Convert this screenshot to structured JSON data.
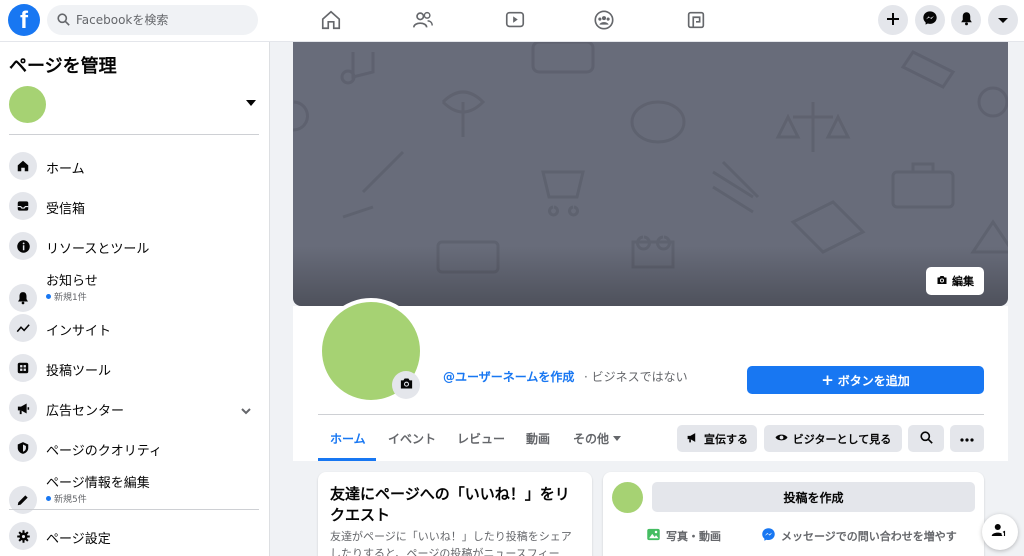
{
  "topbar": {
    "logo": "f",
    "search_placeholder": "Facebookを検索",
    "nav_icons": [
      "home-icon",
      "friends-icon",
      "watch-icon",
      "groups-icon",
      "gaming-icon"
    ],
    "action_icons": [
      "plus-icon",
      "messenger-icon",
      "notifications-icon",
      "account-menu-icon"
    ]
  },
  "sidebar": {
    "title": "ページを管理",
    "items": [
      {
        "label": "ホーム",
        "icon": "home-icon"
      },
      {
        "label": "受信箱",
        "icon": "inbox-icon"
      },
      {
        "label": "リソースとツール",
        "icon": "info-icon"
      },
      {
        "label": "お知らせ",
        "sub": "新規1件",
        "icon": "bell-icon"
      },
      {
        "label": "インサイト",
        "icon": "insights-icon"
      },
      {
        "label": "投稿ツール",
        "icon": "publishing-tools-icon"
      },
      {
        "label": "広告センター",
        "icon": "megaphone-icon"
      },
      {
        "label": "ページのクオリティ",
        "icon": "shield-icon"
      },
      {
        "label": "ページ情報を編集",
        "sub": "新規5件",
        "icon": "pencil-icon"
      },
      {
        "label": "ページ設定",
        "icon": "gear-icon"
      }
    ]
  },
  "cover": {
    "edit_label": "編集"
  },
  "profile": {
    "username_link": "@ユーザーネームを作成",
    "business_note": "· ビジネスではない",
    "add_button_label": "ボタンを追加"
  },
  "tabs": [
    {
      "label": "ホーム",
      "active": true
    },
    {
      "label": "イベント"
    },
    {
      "label": "レビュー"
    },
    {
      "label": "動画"
    },
    {
      "label": "その他"
    }
  ],
  "actions": {
    "promote_label": "宣伝する",
    "view_as_visitor_label": "ビジターとして見る"
  },
  "invite_card": {
    "title": "友達にページへの「いいね！」をリクエスト",
    "body": "友達がページに「いいね！」したり投稿をシェアしたりすると、ページの投稿がニュースフィー"
  },
  "composer": {
    "create_post_label": "投稿を作成",
    "photo_video_label": "写真・動画",
    "messenger_label": "メッセージでの問い合わせを増やす"
  },
  "colors": {
    "brand": "#1877f2",
    "avatar": "#a6d273",
    "cover": "#686c7a"
  }
}
